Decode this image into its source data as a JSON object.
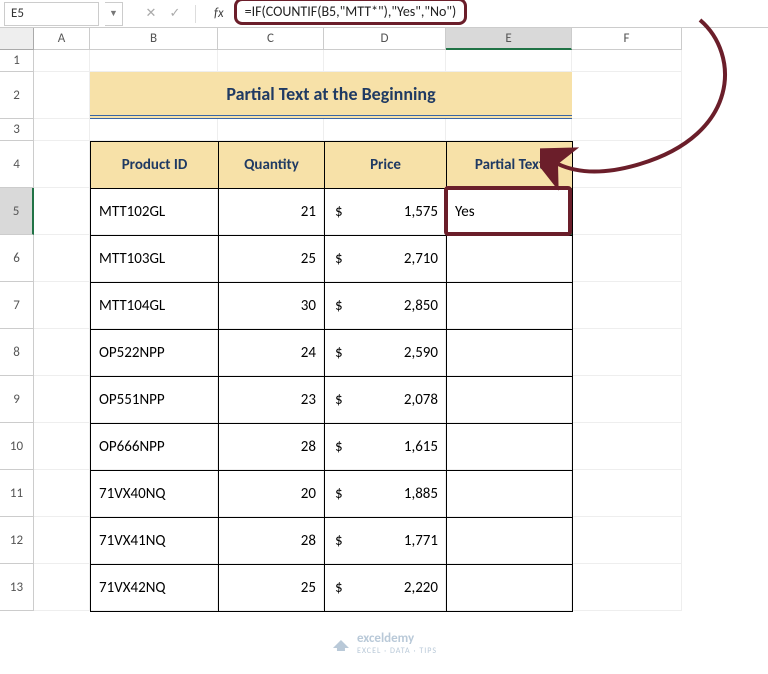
{
  "formula_bar": {
    "cell_ref": "E5",
    "formula": "=IF(COUNTIF(B5,\"MTT*\"),\"Yes\",\"No\")",
    "fx_label": "fx"
  },
  "columns": [
    "A",
    "B",
    "C",
    "D",
    "E",
    "F"
  ],
  "row_numbers": [
    1,
    2,
    3,
    4,
    5,
    6,
    7,
    8,
    9,
    10,
    11,
    12,
    13
  ],
  "title": "Partial Text at the Beginning",
  "headers": {
    "b": "Product ID",
    "c": "Quantity",
    "d": "Price",
    "e": "Partial Text"
  },
  "rows": [
    {
      "product_id": "MTT102GL",
      "qty": "21",
      "currency": "$",
      "price": "1,575",
      "partial": "Yes"
    },
    {
      "product_id": "MTT103GL",
      "qty": "25",
      "currency": "$",
      "price": "2,710",
      "partial": ""
    },
    {
      "product_id": "MTT104GL",
      "qty": "30",
      "currency": "$",
      "price": "2,850",
      "partial": ""
    },
    {
      "product_id": "OP522NPP",
      "qty": "24",
      "currency": "$",
      "price": "2,590",
      "partial": ""
    },
    {
      "product_id": "OP551NPP",
      "qty": "23",
      "currency": "$",
      "price": "2,078",
      "partial": ""
    },
    {
      "product_id": "OP666NPP",
      "qty": "28",
      "currency": "$",
      "price": "1,615",
      "partial": ""
    },
    {
      "product_id": "71VX40NQ",
      "qty": "20",
      "currency": "$",
      "price": "1,885",
      "partial": ""
    },
    {
      "product_id": "71VX41NQ",
      "qty": "28",
      "currency": "$",
      "price": "1,771",
      "partial": ""
    },
    {
      "product_id": "71VX42NQ",
      "qty": "25",
      "currency": "$",
      "price": "2,220",
      "partial": ""
    }
  ],
  "watermark": {
    "brand": "exceldemy",
    "tag": "EXCEL · DATA · TIPS"
  }
}
